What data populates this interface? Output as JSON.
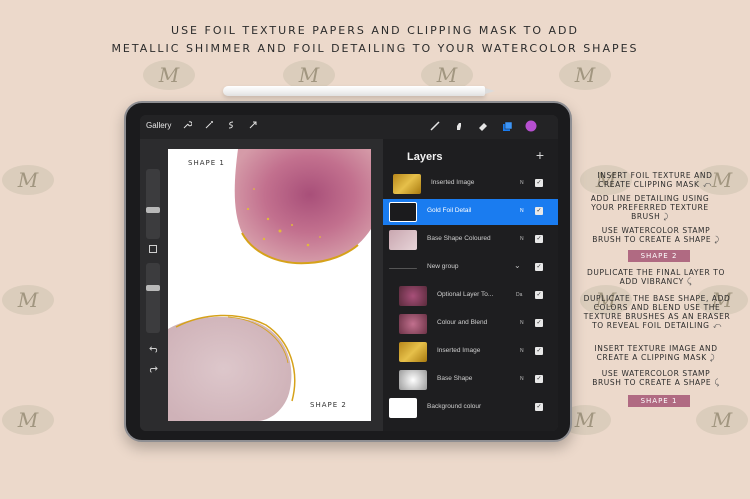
{
  "headline": {
    "line1": "USE FOIL TEXTURE PAPERS AND CLIPPING MASK TO ADD",
    "line2": "METALLIC SHIMMER AND FOIL DETAILING TO YOUR WATERCOLOR SHAPES"
  },
  "watermark_glyph": "M",
  "topbar": {
    "gallery": "Gallery",
    "left_tools": [
      "wrench-icon",
      "magic-wand-icon",
      "selection-icon",
      "transform-arrow-icon"
    ],
    "right_tools": [
      "brush-icon",
      "smudge-icon",
      "eraser-icon",
      "layers-icon",
      "color-swatch-icon"
    ],
    "active_color": "#b64fd0",
    "accent_blue": "#1a7cf0"
  },
  "canvas": {
    "shape1": "SHAPE 1",
    "shape2": "SHAPE 2"
  },
  "layers_panel": {
    "title": "Layers",
    "add": "+",
    "rows": [
      {
        "name": "Inserted Image",
        "blend": "N",
        "selected": false
      },
      {
        "name": "Gold Foil Detail",
        "blend": "N",
        "selected": true
      },
      {
        "name": "Base Shape Coloured",
        "blend": "N",
        "selected": false
      },
      {
        "name": "New group",
        "blend": "",
        "selected": false
      },
      {
        "name": "Optional Layer To...",
        "blend": "Da",
        "selected": false
      },
      {
        "name": "Colour and Blend",
        "blend": "N",
        "selected": false
      },
      {
        "name": "Inserted Image",
        "blend": "N",
        "selected": false
      },
      {
        "name": "Base Shape",
        "blend": "N",
        "selected": false
      },
      {
        "name": "Background colour",
        "blend": "",
        "selected": false
      }
    ]
  },
  "annotations": {
    "a1": "INSERT FOIL TEXTURE AND CREATE CLIPPING MASK",
    "a2": "ADD LINE DETAILING USING YOUR PREFERRED TEXTURE BRUSH",
    "a3": "USE WATERCOLOR STAMP BRUSH TO CREATE A SHAPE",
    "badge2": "SHAPE 2",
    "a4": "DUPLICATE THE FINAL LAYER TO ADD VIBRANCY",
    "a5": "DUPLICATE THE BASE SHAPE, ADD COLORS AND BLEND USE THE TEXTURE BRUSHES AS AN ERASER TO REVEAL FOIL DETAILING",
    "a6": "INSERT TEXTURE IMAGE AND CREATE A CLIPPING MASK",
    "a7": "USE WATERCOLOR STAMP BRUSH TO CREATE A SHAPE",
    "badge1": "SHAPE 1"
  },
  "colors": {
    "background": "#ecd9cb",
    "badge": "#b06a82",
    "gold": "#d6a21a",
    "pink_wash": "#c46f8e"
  }
}
